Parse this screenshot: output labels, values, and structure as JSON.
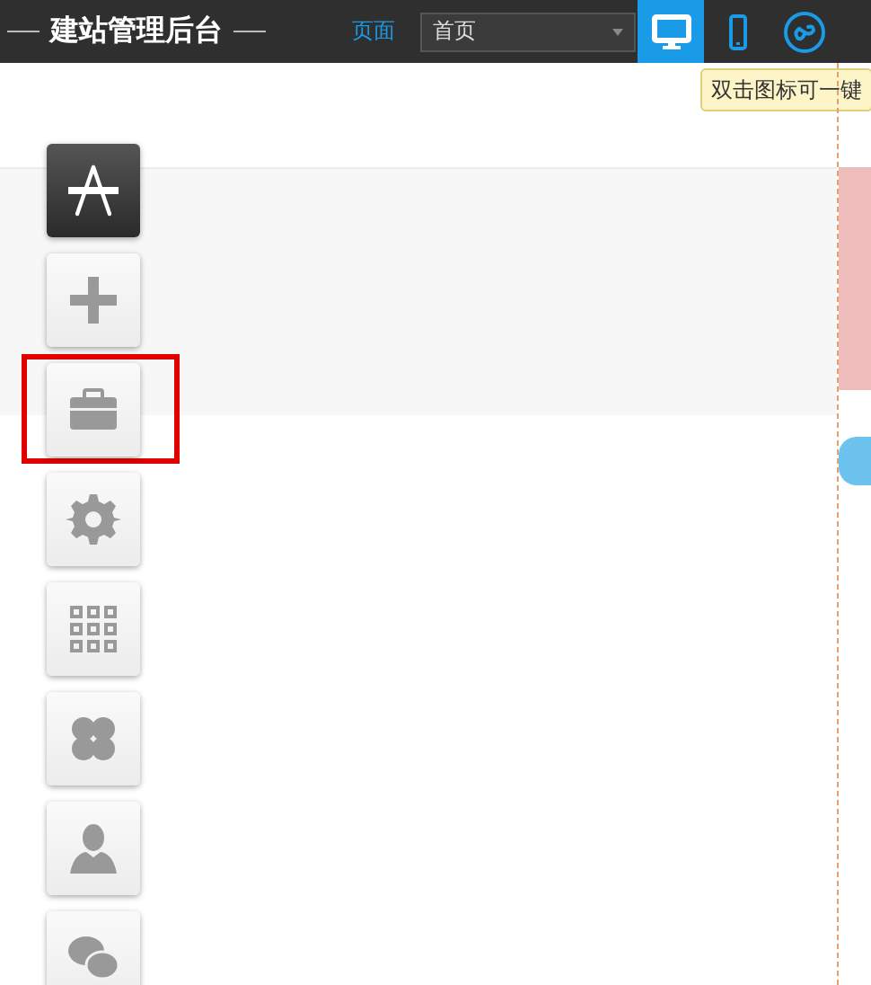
{
  "header": {
    "title": "建站管理后台",
    "page_label": "页面",
    "page_select": {
      "value": "首页"
    },
    "devices": [
      {
        "selected": true
      },
      {
        "selected": false
      },
      {
        "selected": false
      }
    ],
    "tooltip": "双击图标可一键"
  },
  "tools": [
    {
      "selected": true,
      "highlighted": false
    },
    {
      "selected": false,
      "highlighted": false
    },
    {
      "selected": false,
      "highlighted": true
    },
    {
      "selected": false,
      "highlighted": false
    },
    {
      "selected": false,
      "highlighted": false
    },
    {
      "selected": false,
      "highlighted": false
    },
    {
      "selected": false,
      "highlighted": false
    },
    {
      "selected": false,
      "highlighted": false
    }
  ]
}
